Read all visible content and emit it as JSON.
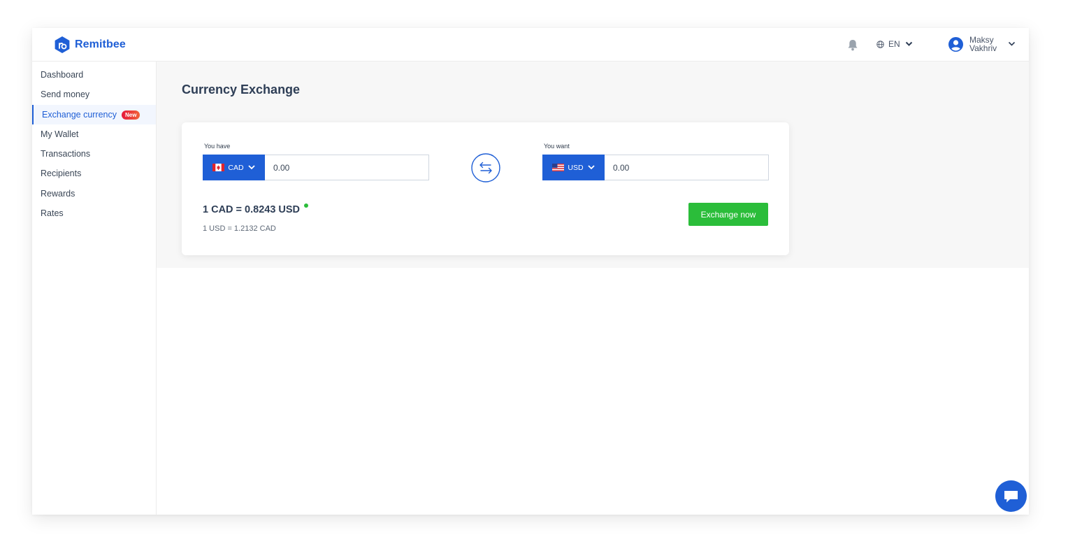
{
  "header": {
    "brand": "Remitbee",
    "language": "EN",
    "user_first": "Maksy",
    "user_last": "Vakhriv"
  },
  "sidebar": {
    "items": [
      {
        "label": "Dashboard"
      },
      {
        "label": "Send money"
      },
      {
        "label": "Exchange currency",
        "badge": "New",
        "active": true
      },
      {
        "label": "My Wallet"
      },
      {
        "label": "Transactions"
      },
      {
        "label": "Recipients"
      },
      {
        "label": "Rewards"
      },
      {
        "label": "Rates"
      }
    ]
  },
  "main": {
    "title": "Currency Exchange",
    "have": {
      "label": "You have",
      "currency": "CAD",
      "value": "0.00"
    },
    "want": {
      "label": "You want",
      "currency": "USD",
      "value": "0.00"
    },
    "rate_main": "1 CAD = 0.8243 USD",
    "rate_sub": "1 USD = 1.2132 CAD",
    "exchange_button": "Exchange now"
  },
  "colors": {
    "brand": "#1f5fd6",
    "accent_green": "#2bbd3a",
    "badge_red": "#e6183b"
  },
  "icons": [
    "logo-icon",
    "bell-icon",
    "globe-icon",
    "chevron-down-icon",
    "avatar-icon",
    "canada-flag-icon",
    "usa-flag-icon",
    "swap-icon",
    "chat-icon"
  ]
}
